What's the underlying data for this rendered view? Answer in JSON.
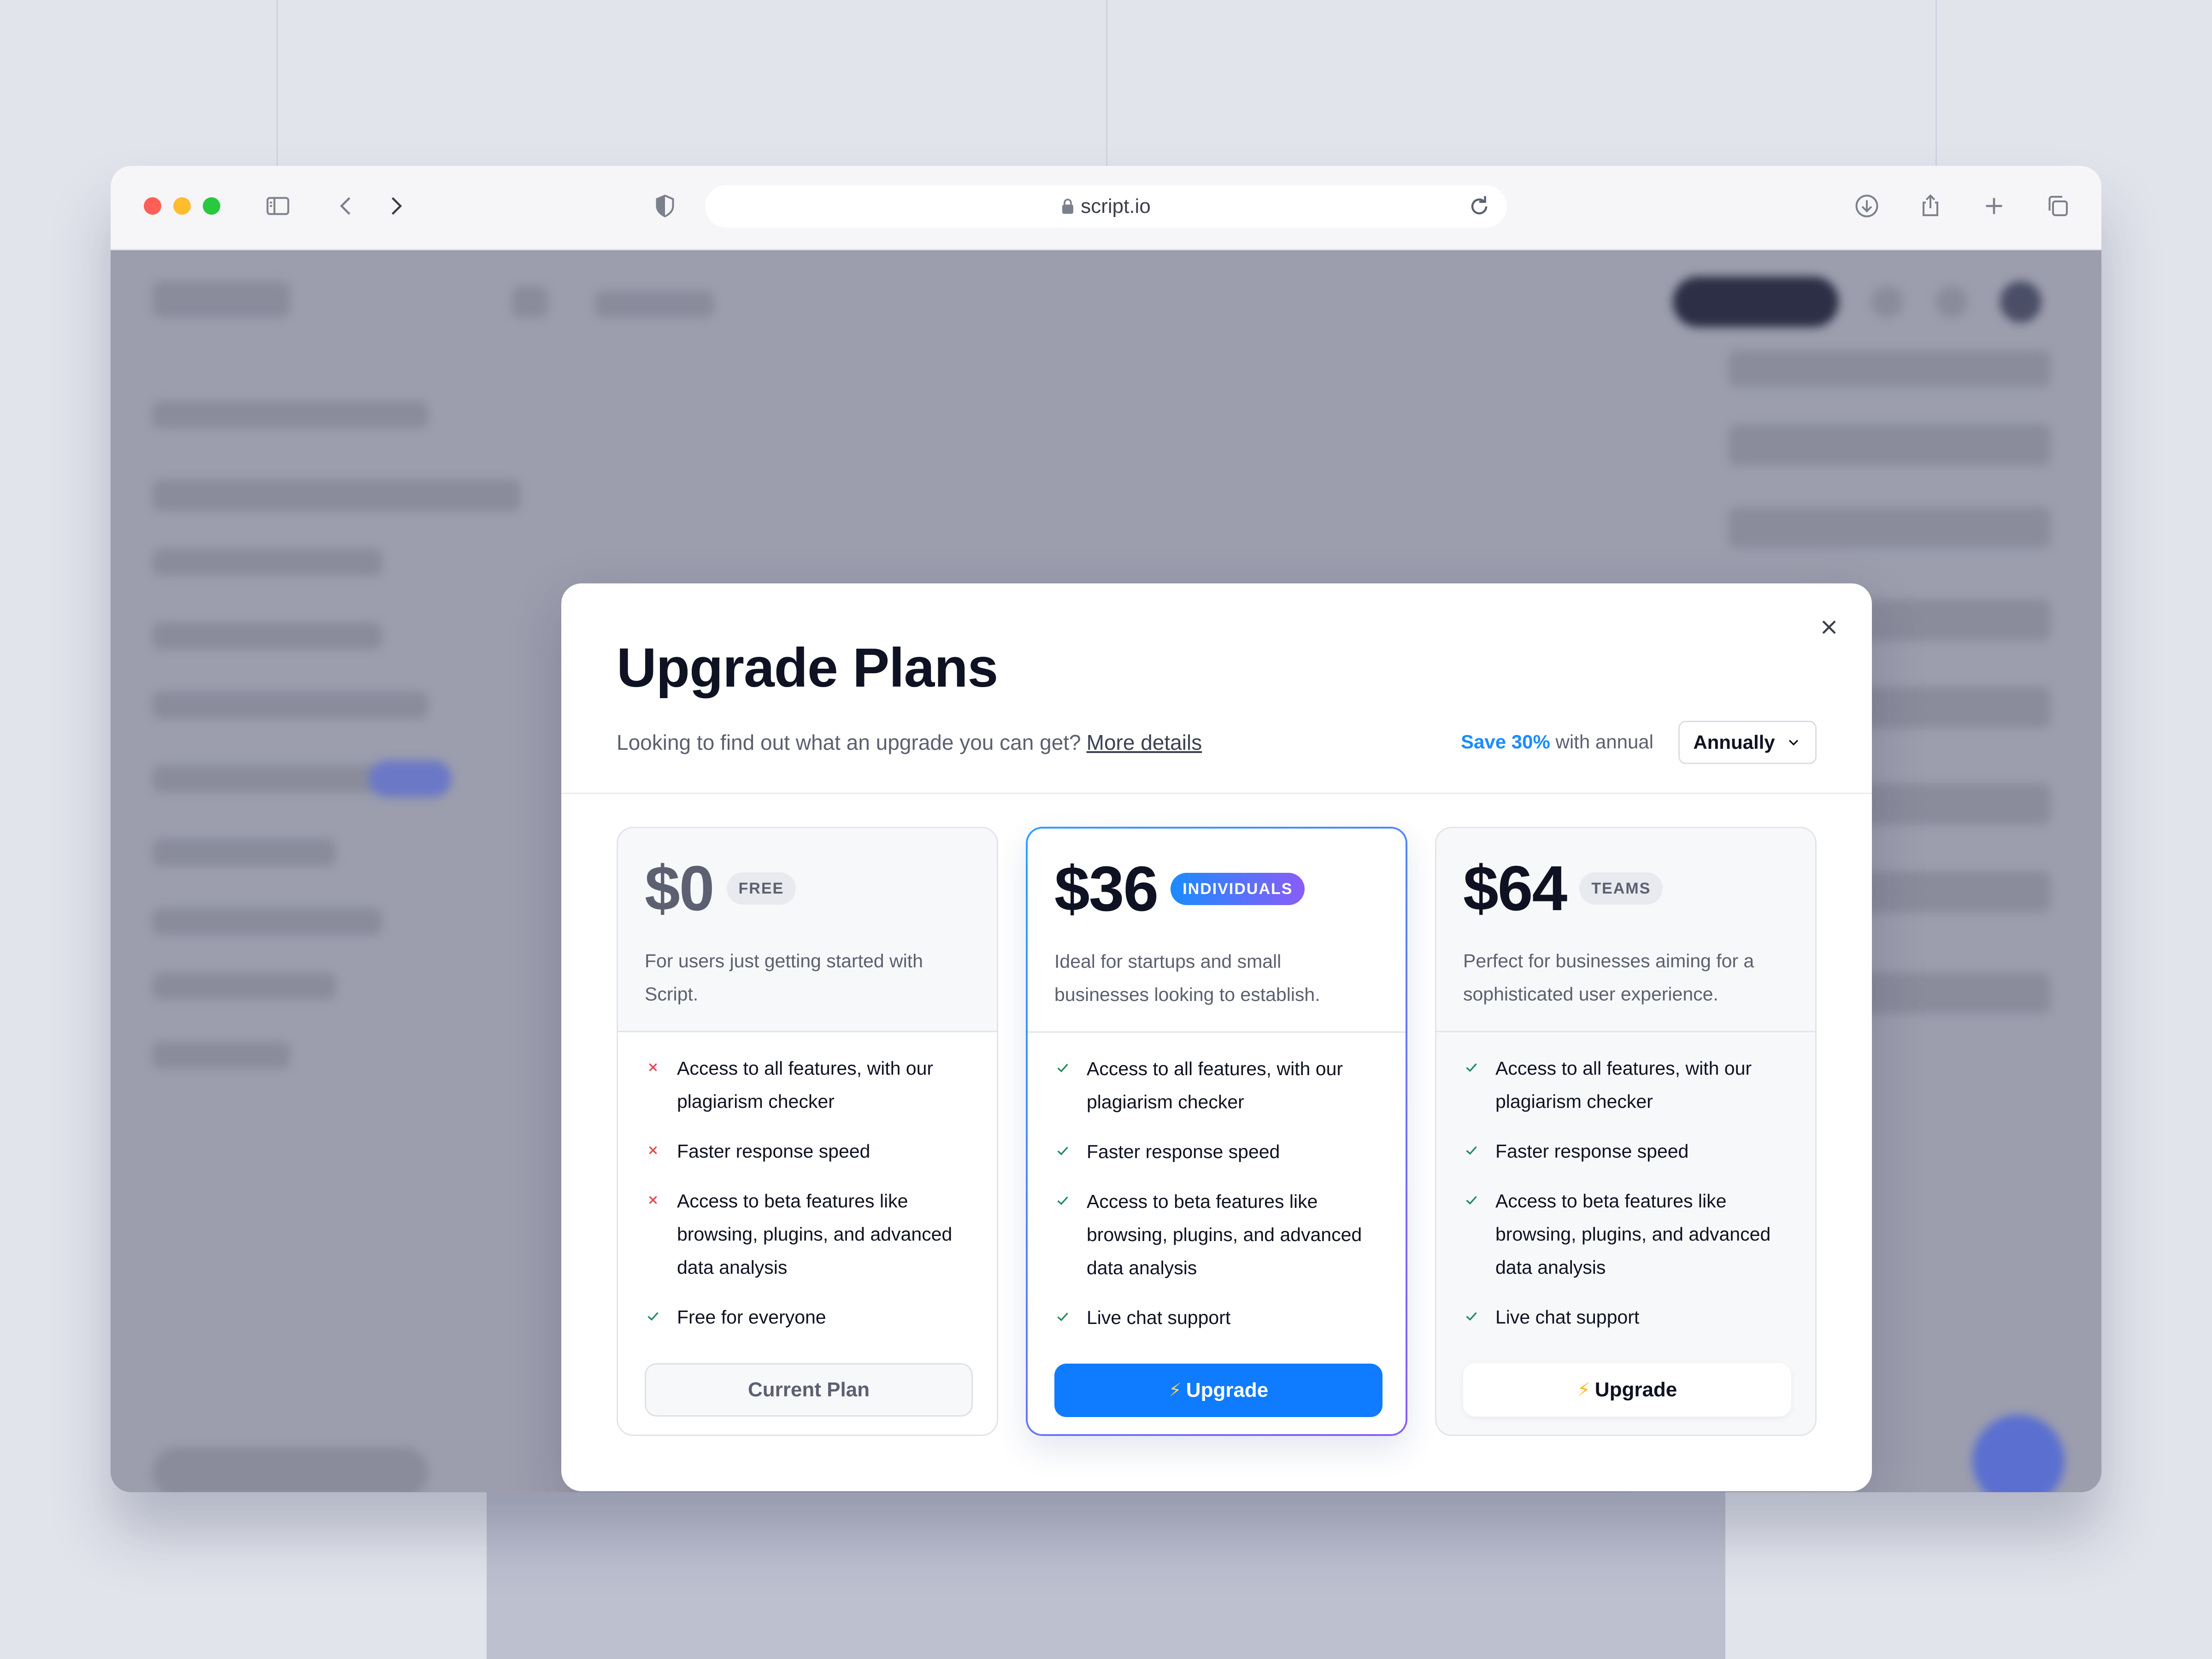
{
  "browser": {
    "url": "script.io"
  },
  "modal": {
    "title": "Upgrade Plans",
    "subtitle": "Looking to find out what an upgrade you can get?",
    "details_link": "More details",
    "save_highlight": "Save 30%",
    "save_rest": "with annual",
    "billing_select": "Annually",
    "plans": [
      {
        "price": "$0",
        "badge": "FREE",
        "description": "For users just getting started with Script.",
        "features": [
          {
            "text": "Access to all features, with our plagiarism checker",
            "included": false
          },
          {
            "text": "Faster response speed",
            "included": false
          },
          {
            "text": "Access to beta features like browsing, plugins, and advanced data analysis",
            "included": false
          },
          {
            "text": "Free for everyone",
            "included": true
          }
        ],
        "button": "Current Plan"
      },
      {
        "price": "$36",
        "badge": "INDIVIDUALS",
        "description": "Ideal for startups and small businesses looking to establish.",
        "features": [
          {
            "text": "Access to all features, with our plagiarism checker",
            "included": true
          },
          {
            "text": "Faster response speed",
            "included": true
          },
          {
            "text": "Access to beta features like browsing, plugins, and advanced data analysis",
            "included": true
          },
          {
            "text": "Live chat support",
            "included": true
          }
        ],
        "button": "Upgrade"
      },
      {
        "price": "$64",
        "badge": "TEAMS",
        "description": "Perfect for businesses aiming for a sophisticated user experience.",
        "features": [
          {
            "text": "Access to all features, with our plagiarism checker",
            "included": true
          },
          {
            "text": "Faster response speed",
            "included": true
          },
          {
            "text": "Access to beta features like browsing, plugins, and advanced data analysis",
            "included": true
          },
          {
            "text": "Live chat support",
            "included": true
          }
        ],
        "button": "Upgrade"
      }
    ]
  },
  "colors": {
    "accent": "#0f7bff",
    "check": "#1e8c5a",
    "cross": "#e5484d",
    "gradient_start": "#2ea0ff",
    "gradient_end": "#8b5cf6"
  }
}
